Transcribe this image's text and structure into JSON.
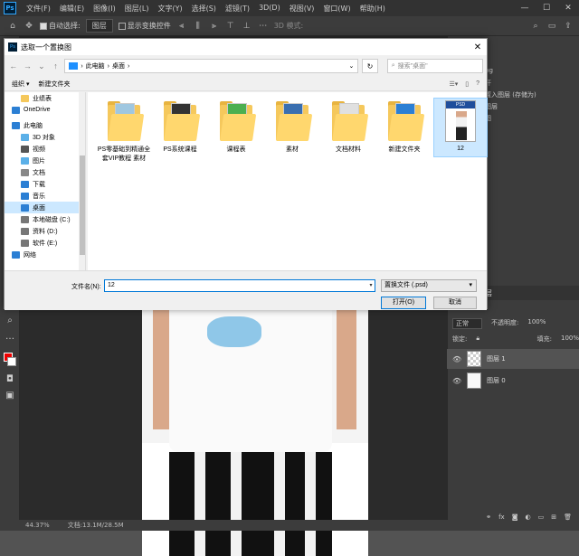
{
  "app": {
    "logo": "Ps",
    "menus": [
      "文件(F)",
      "编辑(E)",
      "图像(I)",
      "图层(L)",
      "文字(Y)",
      "选择(S)",
      "滤镜(T)",
      "3D(D)",
      "视图(V)",
      "窗口(W)",
      "帮助(H)"
    ],
    "options": {
      "auto_select_label": "自动选择:",
      "auto_select_value": "图层",
      "show_transform_label": "显示变换控件",
      "mode_3d": "3D 模式:"
    }
  },
  "status": {
    "zoom": "44.37%",
    "doc": "文档:13.1M/28.5M"
  },
  "history": {
    "items": [
      "pg",
      "开",
      "置入图层 (存储为)",
      "图层",
      "图"
    ]
  },
  "layers": {
    "tabs": [
      "通道",
      "图层"
    ],
    "blend_mode": "正常",
    "opacity_label": "不透明度:",
    "opacity_value": "100%",
    "lock_label": "锁定:",
    "fill_label": "填充:",
    "fill_value": "100%",
    "items": [
      {
        "name": "图层 1"
      },
      {
        "name": "图层 0"
      }
    ],
    "footer": "fx"
  },
  "dialog": {
    "title": "选取一个置换图",
    "path": [
      "此电脑",
      "桌面"
    ],
    "search_placeholder": "搜索\"桌面\"",
    "organize": "组织",
    "new_folder": "新建文件夹",
    "nav": [
      {
        "label": "业绩表",
        "sub": true,
        "color": "#f5c85c"
      },
      {
        "label": "OneDrive",
        "sub": false,
        "color": "#2b7fd4"
      },
      {
        "label": "此电脑",
        "sub": false,
        "color": "#2b7fd4"
      },
      {
        "label": "3D 对象",
        "sub": true,
        "color": "#5bb0e8"
      },
      {
        "label": "视频",
        "sub": true,
        "color": "#555"
      },
      {
        "label": "图片",
        "sub": true,
        "color": "#5bb0e8"
      },
      {
        "label": "文档",
        "sub": true,
        "color": "#888"
      },
      {
        "label": "下载",
        "sub": true,
        "color": "#2b7fd4"
      },
      {
        "label": "音乐",
        "sub": true,
        "color": "#2b7fd4"
      },
      {
        "label": "桌面",
        "sub": true,
        "color": "#2b7fd4"
      },
      {
        "label": "本地磁盘 (C:)",
        "sub": true,
        "color": "#777"
      },
      {
        "label": "资料 (D:)",
        "sub": true,
        "color": "#777"
      },
      {
        "label": "软件 (E:)",
        "sub": true,
        "color": "#777"
      },
      {
        "label": "网络",
        "sub": false,
        "color": "#2b7fd4"
      }
    ],
    "files": [
      {
        "name": "PS零基础到精通全套VIP教程 素材",
        "kind": "folder",
        "doc_color": "#9fc7e0"
      },
      {
        "name": "PS系统课程",
        "kind": "folder",
        "doc_color": "#333"
      },
      {
        "name": "课程表",
        "kind": "folder",
        "doc_color": "#4caf50"
      },
      {
        "name": "素材",
        "kind": "folder",
        "doc_color": "#3a6fb0"
      },
      {
        "name": "文档材料",
        "kind": "folder",
        "doc_color": "#e0e0e0"
      },
      {
        "name": "新建文件夹",
        "kind": "folder",
        "doc_color": "#2b7fd4"
      },
      {
        "name": "12",
        "kind": "psd",
        "doc_color": "#1f4e9c"
      }
    ],
    "filename_label": "文件名(N):",
    "filename_value": "12",
    "filetype": "置换文件 (.psd)",
    "open_label": "打开(O)",
    "cancel_label": "取消"
  }
}
